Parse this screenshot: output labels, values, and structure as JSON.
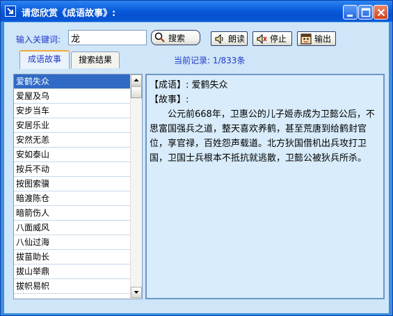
{
  "window": {
    "title": "请您欣赏《成语故事》:"
  },
  "search": {
    "label": "输入关键词:",
    "value": "龙",
    "button_label": "搜索"
  },
  "toolbar": {
    "read_label": "朗读",
    "stop_label": "停止",
    "exit_label": "输出"
  },
  "tabs": [
    {
      "label": "成语故事",
      "active": true
    },
    {
      "label": "搜索结果",
      "active": false
    }
  ],
  "record": {
    "text": "当前记录: 1/833条"
  },
  "idioms": [
    "爱鹤失众",
    "爱屋及乌",
    "安步当车",
    "安居乐业",
    "安然无恙",
    "安如泰山",
    "按兵不动",
    "按图索骥",
    "暗渡陈仓",
    "暗箭伤人",
    "八面威风",
    "八仙过海",
    "拔苗助长",
    "拔山举鼎",
    "拔帜易帜"
  ],
  "selected_index": 0,
  "story": {
    "idiom_line": "【成语】: 爱鹤失众",
    "story_heading": "【故事】:",
    "text": "公元前668年，卫惠公的儿子姬赤成为卫懿公后，不思富国强兵之道，整天喜欢养鹤，甚至荒唐到给鹤封官位，享官禄，百姓怨声载道。北方狄国借机出兵攻打卫国，卫国士兵根本不抵抗就逃散，卫懿公被狄兵所杀。"
  },
  "icons": {
    "app": "arrow-icon",
    "search": "magnifier-icon",
    "read": "speaker-icon",
    "stop": "speaker-stop-icon",
    "exit": "face-icon"
  },
  "colors": {
    "titlebar": "#0a5ddc",
    "client_bg": "#cfe5f8",
    "label_blue": "#1e38c8",
    "selection": "#316ac5",
    "story_bg": "#d8ecfb"
  }
}
